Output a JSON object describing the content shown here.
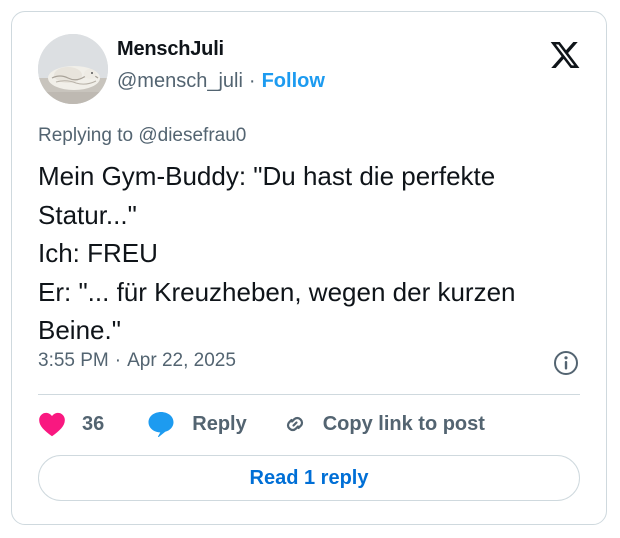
{
  "author": {
    "display_name": "MenschJuli",
    "name_emoji_before": "",
    "name_emoji_after": "",
    "handle": "@mensch_juli",
    "separator": "·",
    "follow_label": "Follow"
  },
  "tweet": {
    "replying_to": "Replying to @diesefrau0",
    "lines": [
      "Mein Gym-Buddy: \"Du hast die perfekte",
      "Statur...\"",
      "Ich: FREU",
      "Er: \"... für Kreuzheben, wegen der kurzen",
      "Beine.\""
    ],
    "time": "3:55 PM",
    "separator": "·",
    "date": "Apr 22, 2025"
  },
  "actions": {
    "like_count": "36",
    "reply_label": "Reply",
    "copy_label": "Copy link to post"
  },
  "read_replies_label": "Read 1 reply",
  "icons": {
    "logo": "x-logo-icon",
    "info": "info-icon",
    "like": "heart-icon",
    "reply": "reply-bubble-icon",
    "copy": "link-icon"
  },
  "colors": {
    "like": "#f91880",
    "reply": "#1d9bf0",
    "follow": "#1d9bf0",
    "read_button_text": "#006fd6",
    "secondary_text": "#536471",
    "border": "#cfd9de"
  }
}
